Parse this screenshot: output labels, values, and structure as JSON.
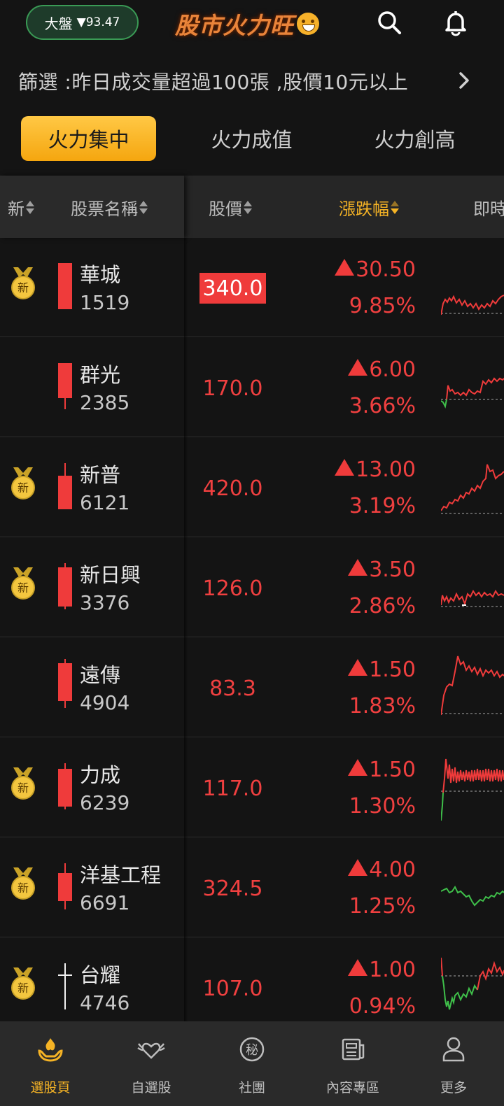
{
  "header": {
    "index_label": "大盤",
    "index_change": "▼93.47",
    "app_title": "股市火力旺"
  },
  "filter": {
    "text": "篩選 :昨日成交量超過100張 ,股價10元以上"
  },
  "tabs": [
    {
      "label": "火力集中",
      "active": true
    },
    {
      "label": "火力成值",
      "active": false
    },
    {
      "label": "火力創高",
      "active": false
    }
  ],
  "columns": {
    "new": "新",
    "name": "股票名稱",
    "price": "股價",
    "change": "漲跌幅",
    "realtime": "即時"
  },
  "stocks": [
    {
      "name": "華城",
      "code": "1519",
      "price": "340.0",
      "change": "30.50",
      "pct": "9.85%",
      "is_new": true,
      "price_highlight": true
    },
    {
      "name": "群光",
      "code": "2385",
      "price": "170.0",
      "change": "6.00",
      "pct": "3.66%",
      "is_new": false,
      "price_highlight": false
    },
    {
      "name": "新普",
      "code": "6121",
      "price": "420.0",
      "change": "13.00",
      "pct": "3.19%",
      "is_new": true,
      "price_highlight": false
    },
    {
      "name": "新日興",
      "code": "3376",
      "price": "126.0",
      "change": "3.50",
      "pct": "2.86%",
      "is_new": true,
      "price_highlight": false
    },
    {
      "name": "遠傳",
      "code": "4904",
      "price": "83.3",
      "change": "1.50",
      "pct": "1.83%",
      "is_new": false,
      "price_highlight": false
    },
    {
      "name": "力成",
      "code": "6239",
      "price": "117.0",
      "change": "1.50",
      "pct": "1.30%",
      "is_new": true,
      "price_highlight": false
    },
    {
      "name": "洋基工程",
      "code": "6691",
      "price": "324.5",
      "change": "4.00",
      "pct": "1.25%",
      "is_new": true,
      "price_highlight": false
    },
    {
      "name": "台耀",
      "code": "4746",
      "price": "107.0",
      "change": "1.00",
      "pct": "0.94%",
      "is_new": true,
      "price_highlight": false
    }
  ],
  "badge_text": "新",
  "bottom_nav": [
    {
      "label": "選股頁",
      "icon": "hand-flame-icon",
      "active": true
    },
    {
      "label": "自選股",
      "icon": "winged-heart-icon",
      "active": false
    },
    {
      "label": "社團",
      "icon": "secret-circle-icon",
      "active": false
    },
    {
      "label": "內容專區",
      "icon": "newspaper-icon",
      "active": false
    },
    {
      "label": "更多",
      "icon": "person-icon",
      "active": false
    }
  ],
  "nav_icon_text": {
    "secret": "秘"
  },
  "colors": {
    "up": "#ef3b3b",
    "down": "#3fbf4a",
    "accent": "#f5b325",
    "background": "#141414"
  }
}
